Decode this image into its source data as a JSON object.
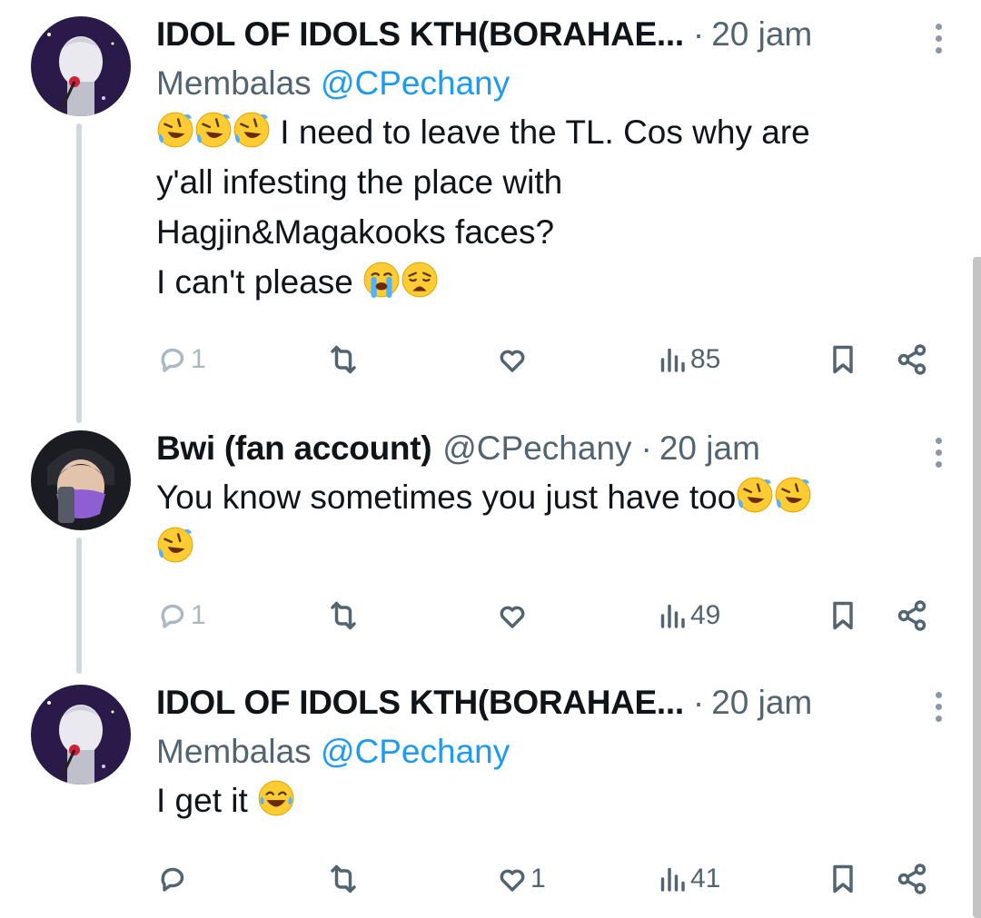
{
  "tweets": [
    {
      "name": "IDOL OF IDOLS KTH(BORAHAE...",
      "time": "20 jam",
      "reply_prefix": "Membalas",
      "reply_to": "@CPechany",
      "text_line1": " I need to leave the TL. Cos why are",
      "text_line2": "y'all infesting the place with",
      "text_line3": "Hagjin&Magakooks faces?",
      "text_line4": "I can't please ",
      "replies": "1",
      "retweets": "",
      "likes": "",
      "views": "85"
    },
    {
      "name": "Bwi (fan account)",
      "handle": "@CPechany",
      "time": "20 jam",
      "text_line1": "You know sometimes you just have too",
      "replies": "1",
      "retweets": "",
      "likes": "",
      "views": "49"
    },
    {
      "name": "IDOL OF IDOLS KTH(BORAHAE...",
      "time": "20 jam",
      "reply_prefix": "Membalas",
      "reply_to": "@CPechany",
      "text_line1": "I get it ",
      "replies": "",
      "retweets": "",
      "likes": "1",
      "views": "41"
    }
  ],
  "separator": "·",
  "icons": [
    "reply-icon",
    "retweet-icon",
    "like-icon",
    "views-icon",
    "bookmark-icon",
    "share-icon",
    "more-icon"
  ],
  "emoji": [
    "rolling-on-floor-laughing",
    "loudly-crying",
    "weary",
    "tears-of-joy"
  ],
  "colors": {
    "text": "#0f1419",
    "secondary": "#536471",
    "link": "#1d9bf0",
    "thread_line": "#cfd9de"
  }
}
